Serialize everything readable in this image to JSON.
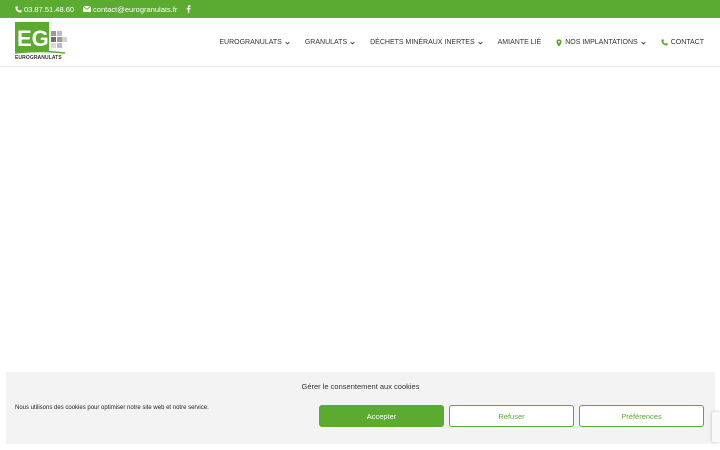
{
  "topbar": {
    "phone": "03.87.51.48.60",
    "email": "contact@eurogranulats.fr",
    "phone_icon": "phone-icon",
    "email_icon": "envelope-icon",
    "social_icon": "facebook-icon"
  },
  "logo": {
    "letters": "EG",
    "name": "EUROGRANULATS"
  },
  "nav": {
    "items": [
      {
        "label": "EUROGRANULATS",
        "has_dropdown": true
      },
      {
        "label": "GRANULATS",
        "has_dropdown": true
      },
      {
        "label": "DÉCHETS MINÉRAUX INERTES",
        "has_dropdown": true
      },
      {
        "label": "AMIANTE LIÉ",
        "has_dropdown": false
      },
      {
        "label": "NOS IMPLANTATIONS",
        "has_dropdown": true,
        "icon": "map-pin-icon"
      },
      {
        "label": "CONTACT",
        "has_dropdown": false,
        "icon": "phone-icon"
      }
    ]
  },
  "cookie_banner": {
    "title": "Gérer le consentement aux cookies",
    "message": "Nous utilisons des cookies pour optimiser notre site web et notre service.",
    "accept_label": "Accepter",
    "refuse_label": "Refuser",
    "preferences_label": "Préférences"
  },
  "colors": {
    "brand_green": "#5aab2f",
    "banner_bg": "#f3f3f3"
  }
}
